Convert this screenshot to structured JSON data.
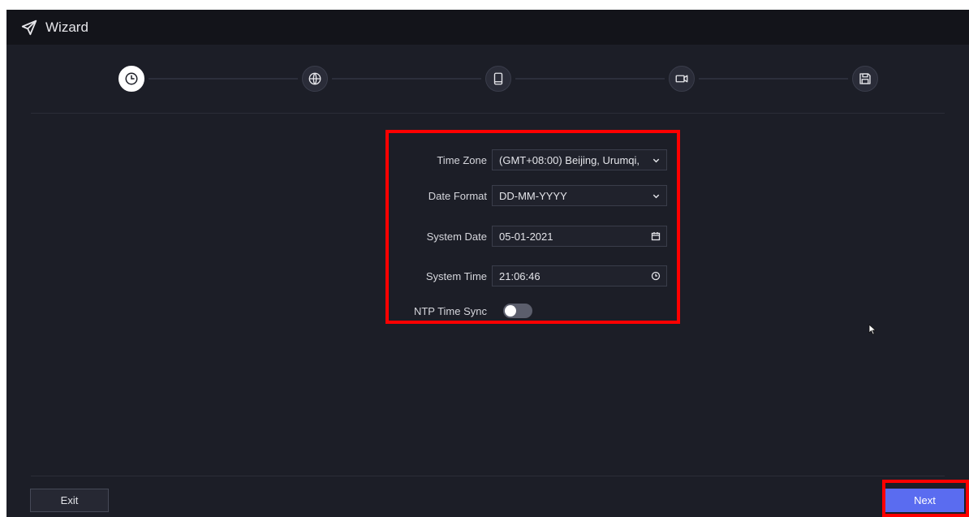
{
  "window": {
    "title": "Wizard",
    "icon": "paper-plane-icon"
  },
  "steps": [
    {
      "name": "time",
      "icon": "clock-icon",
      "active": true
    },
    {
      "name": "network",
      "icon": "globe-icon",
      "active": false
    },
    {
      "name": "mobile",
      "icon": "mobile-icon",
      "active": false
    },
    {
      "name": "camera",
      "icon": "camera-icon",
      "active": false
    },
    {
      "name": "storage",
      "icon": "save-icon",
      "active": false
    }
  ],
  "form": {
    "time_zone": {
      "label": "Time Zone",
      "value": "(GMT+08:00) Beijing, Urumqi,",
      "icon": "chevron-down-icon"
    },
    "date_format": {
      "label": "Date Format",
      "value": "DD-MM-YYYY",
      "icon": "chevron-down-icon"
    },
    "system_date": {
      "label": "System Date",
      "value": "05-01-2021",
      "icon": "calendar-icon"
    },
    "system_time": {
      "label": "System Time",
      "value": "21:06:46",
      "icon": "clock-icon"
    },
    "ntp_time_sync": {
      "label": "NTP Time Sync",
      "enabled": false
    }
  },
  "footer": {
    "exit_label": "Exit",
    "next_label": "Next"
  },
  "colors": {
    "background": "#1c1e27",
    "titlebar": "#13141a",
    "accent": "#5a6cf0",
    "highlight": "#ff0000"
  }
}
